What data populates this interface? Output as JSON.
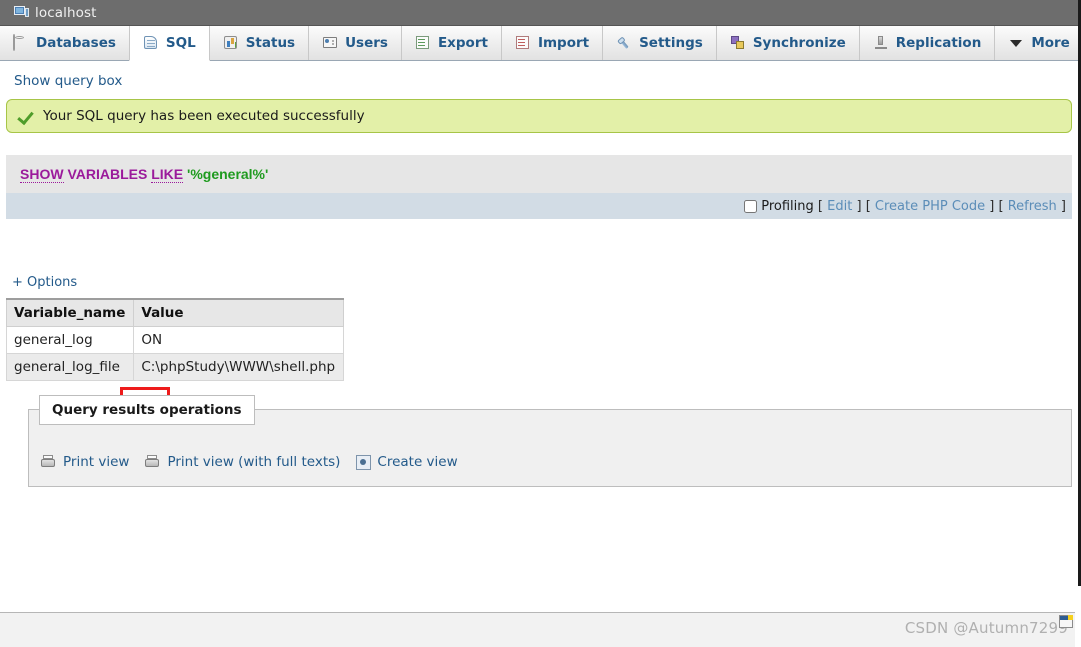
{
  "titlebar": {
    "icon": "server-monitor-icon",
    "label": "localhost"
  },
  "nav": {
    "tabs": [
      {
        "label": "Databases",
        "icon": "database-icon",
        "active": false
      },
      {
        "label": "SQL",
        "icon": "sql-scroll-icon",
        "active": true
      },
      {
        "label": "Status",
        "icon": "status-chart-icon",
        "active": false
      },
      {
        "label": "Users",
        "icon": "users-icon",
        "active": false
      },
      {
        "label": "Export",
        "icon": "export-icon",
        "active": false
      },
      {
        "label": "Import",
        "icon": "import-icon",
        "active": false
      },
      {
        "label": "Settings",
        "icon": "wrench-icon",
        "active": false
      },
      {
        "label": "Synchronize",
        "icon": "synchronize-icon",
        "active": false
      },
      {
        "label": "Replication",
        "icon": "replication-icon",
        "active": false
      },
      {
        "label": "More",
        "icon": "chevron-down-icon",
        "active": false
      }
    ]
  },
  "toolbar": {
    "show_query_box": "Show query box"
  },
  "notice": {
    "icon": "green-check-icon",
    "message": "Your SQL query has been executed successfully"
  },
  "query": {
    "keyword1": "SHOW",
    "keyword2": "VARIABLES",
    "keyword3": "LIKE",
    "string": "'%general%'"
  },
  "profiling": {
    "label": "Profiling",
    "bracket_open": "[",
    "bracket_close": "]",
    "edit": "Edit",
    "create_php_code": "Create PHP Code",
    "refresh": "Refresh",
    "checked": false
  },
  "options": {
    "label": "+ Options"
  },
  "results": {
    "columns": [
      "Variable_name",
      "Value"
    ],
    "rows": [
      {
        "variable_name": "general_log",
        "value": "ON"
      },
      {
        "variable_name": "general_log_file",
        "value": "C:\\phpStudy\\WWW\\shell.php"
      }
    ],
    "highlight": {
      "target": "ON",
      "color": "#ee1b1b"
    }
  },
  "query_results_operations": {
    "legend": "Query results operations",
    "operations": [
      {
        "label": "Print view",
        "icon": "printer-icon"
      },
      {
        "label": "Print view (with full texts)",
        "icon": "printer-icon"
      },
      {
        "label": "Create view",
        "icon": "create-view-icon"
      }
    ]
  },
  "footer": {
    "watermark": "CSDN @Autumn7299",
    "corner_icon": "window-panel-icon"
  },
  "colors": {
    "titlebar_bg": "#6d6d6d",
    "tab_link": "#235a8a",
    "success_bg": "#e3f0a8",
    "success_border": "#a7c547",
    "sql_keyword": "#9b1a9b",
    "sql_string": "#1f9b1f",
    "profiling_bg": "#d2dce5",
    "annotation": "#ee1b1b"
  }
}
